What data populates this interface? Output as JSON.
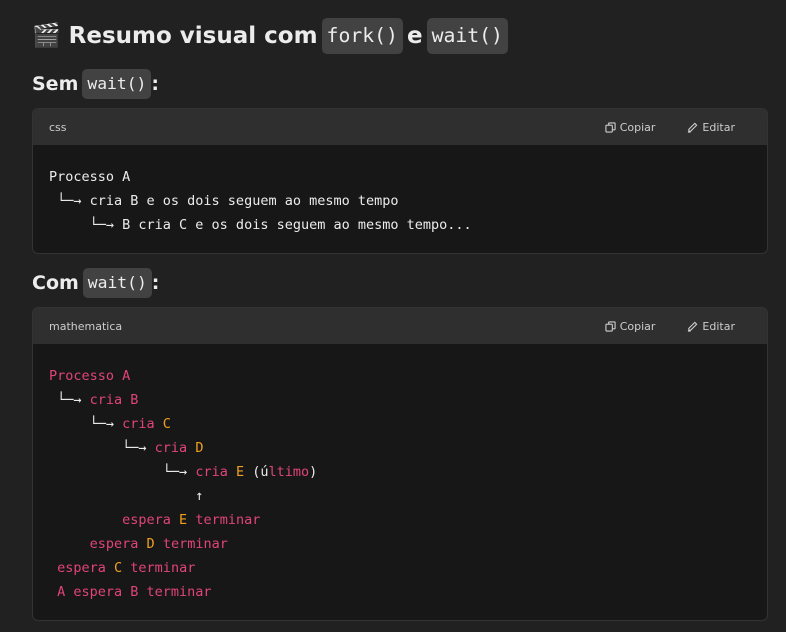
{
  "heading": {
    "emoji": "🎬",
    "text_before": "Resumo visual com",
    "code_1": "fork()",
    "text_mid": "e",
    "code_2": "wait()"
  },
  "section_1": {
    "label": "Sem",
    "code": "wait()",
    "suffix": ":",
    "block": {
      "language": "css",
      "copy_label": "Copiar",
      "edit_label": "Editar",
      "lines": [
        "Processo A",
        " └─→ cria B e os dois seguem ao mesmo tempo",
        "     └─→ B cria C e os dois seguem ao mesmo tempo..."
      ]
    }
  },
  "section_2": {
    "label": "Com",
    "code": "wait()",
    "suffix": ":",
    "block": {
      "language": "mathematica",
      "copy_label": "Copiar",
      "edit_label": "Editar",
      "lines": [
        [
          {
            "t": "Processo A",
            "c": "red"
          }
        ],
        [
          {
            "t": " └─→ ",
            "c": "wht"
          },
          {
            "t": "cria B",
            "c": "red"
          }
        ],
        [
          {
            "t": "     └─→ ",
            "c": "wht"
          },
          {
            "t": "cria ",
            "c": "red"
          },
          {
            "t": "C",
            "c": "org"
          }
        ],
        [
          {
            "t": "         └─→ ",
            "c": "wht"
          },
          {
            "t": "cria ",
            "c": "red"
          },
          {
            "t": "D",
            "c": "org"
          }
        ],
        [
          {
            "t": "              └─→ ",
            "c": "wht"
          },
          {
            "t": "cria ",
            "c": "red"
          },
          {
            "t": "E",
            "c": "org"
          },
          {
            "t": " (ú",
            "c": "wht"
          },
          {
            "t": "ltimo",
            "c": "red"
          },
          {
            "t": ")",
            "c": "wht"
          }
        ],
        [
          {
            "t": "                  ↑",
            "c": "wht"
          }
        ],
        [
          {
            "t": "         espera ",
            "c": "red"
          },
          {
            "t": "E",
            "c": "org"
          },
          {
            "t": " terminar",
            "c": "red"
          }
        ],
        [
          {
            "t": "     espera ",
            "c": "red"
          },
          {
            "t": "D",
            "c": "org"
          },
          {
            "t": " terminar",
            "c": "red"
          }
        ],
        [
          {
            "t": " espera ",
            "c": "red"
          },
          {
            "t": "C",
            "c": "org"
          },
          {
            "t": " terminar",
            "c": "red"
          }
        ],
        [
          {
            "t": " A espera B terminar",
            "c": "red"
          }
        ]
      ]
    }
  },
  "colors": {
    "background": "#212121",
    "code_bg": "#171717",
    "code_header_bg": "#2f2f2f",
    "keyword_red": "#e0447a",
    "keyword_orange": "#f0a020"
  }
}
